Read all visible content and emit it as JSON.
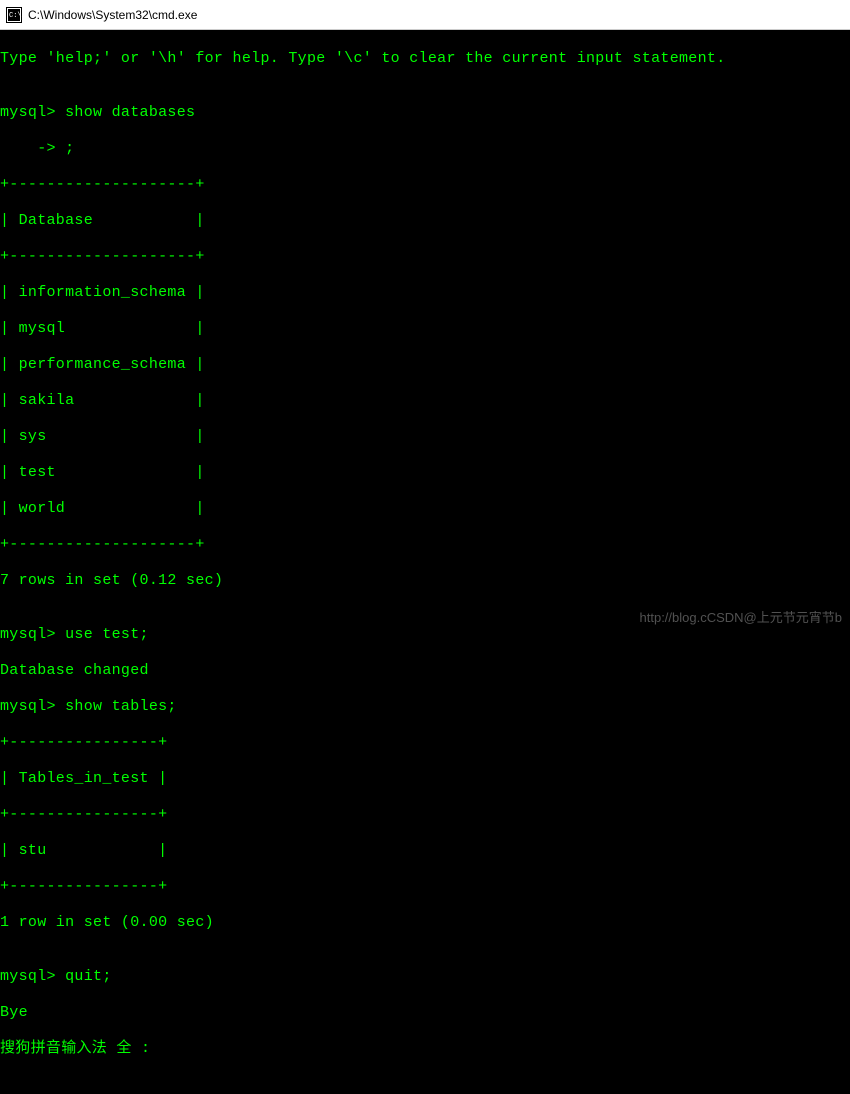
{
  "titlebar": {
    "label": "C:\\Windows\\System32\\cmd.exe"
  },
  "terminal": {
    "help_line": "Type 'help;' or '\\h' for help. Type '\\c' to clear the current input statement.",
    "blank": "",
    "prompt1": "mysql> show databases",
    "prompt1b": "    -> ;",
    "tbl1_border": "+--------------------+",
    "tbl1_header": "| Database           |",
    "tbl1_r1": "| information_schema |",
    "tbl1_r2": "| mysql              |",
    "tbl1_r3": "| performance_schema |",
    "tbl1_r4": "| sakila             |",
    "tbl1_r5": "| sys                |",
    "tbl1_r6": "| test               |",
    "tbl1_r7": "| world              |",
    "tbl1_summary": "7 rows in set (0.12 sec)",
    "prompt2": "mysql> use test;",
    "changed": "Database changed",
    "prompt3": "mysql> show tables;",
    "tbl2_border": "+----------------+",
    "tbl2_header": "| Tables_in_test |",
    "tbl2_r1": "| stu            |",
    "tbl2_summary": "1 row in set (0.00 sec)",
    "prompt4": "mysql> quit;",
    "bye": "Bye",
    "ime": "搜狗拼音输入法 全 :"
  },
  "watermark": {
    "text": "http://blog.cCSDN@上元节元宵节b"
  }
}
